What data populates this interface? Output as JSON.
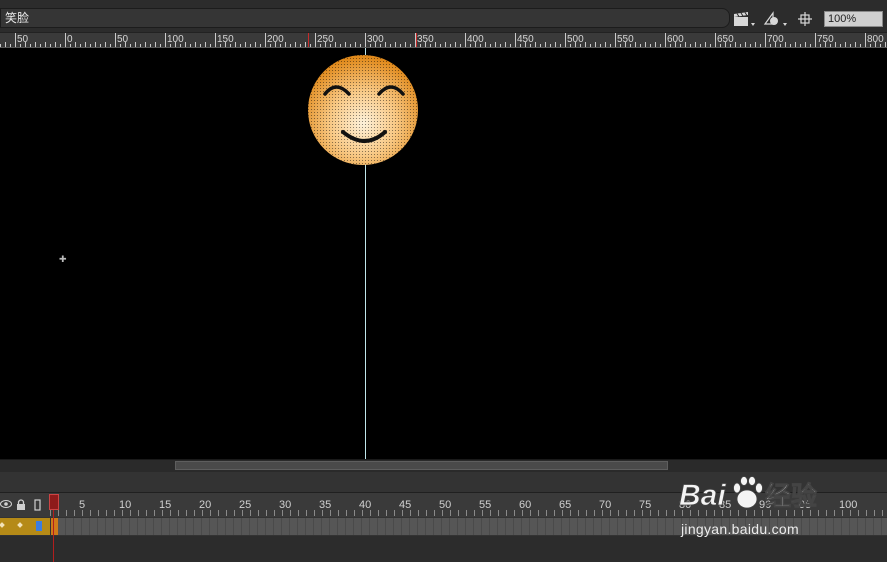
{
  "scene": {
    "name": "笑脸"
  },
  "toolbar": {
    "edit_scene_icon": "clapper-icon",
    "edit_symbol_icon": "shapes-icon",
    "center_stage_icon": "crosshair-icon",
    "zoom": "100%"
  },
  "ruler": {
    "labels": [
      "50",
      "0",
      "50",
      "100",
      "150",
      "200",
      "250",
      "300",
      "350",
      "400",
      "450",
      "500",
      "550",
      "600",
      "650",
      "700",
      "750",
      "800"
    ]
  },
  "timeline": {
    "frame_numbers": [
      "1",
      "5",
      "10",
      "15",
      "20",
      "25",
      "30",
      "35",
      "40",
      "45",
      "50",
      "55",
      "60",
      "65",
      "70",
      "75",
      "80",
      "85",
      "90",
      "95",
      "100"
    ],
    "header_icons": [
      "eye-icon",
      "lock-icon",
      "outline-icon"
    ]
  },
  "watermark": {
    "brand": "Baidu经验",
    "url": "jingyan.baidu.com"
  },
  "colors": {
    "stage": "#000000",
    "face_light": "#fde7c0",
    "face_dark": "#e8901c",
    "layer_highlight": "#b58a17",
    "playhead": "#b21e1e"
  }
}
